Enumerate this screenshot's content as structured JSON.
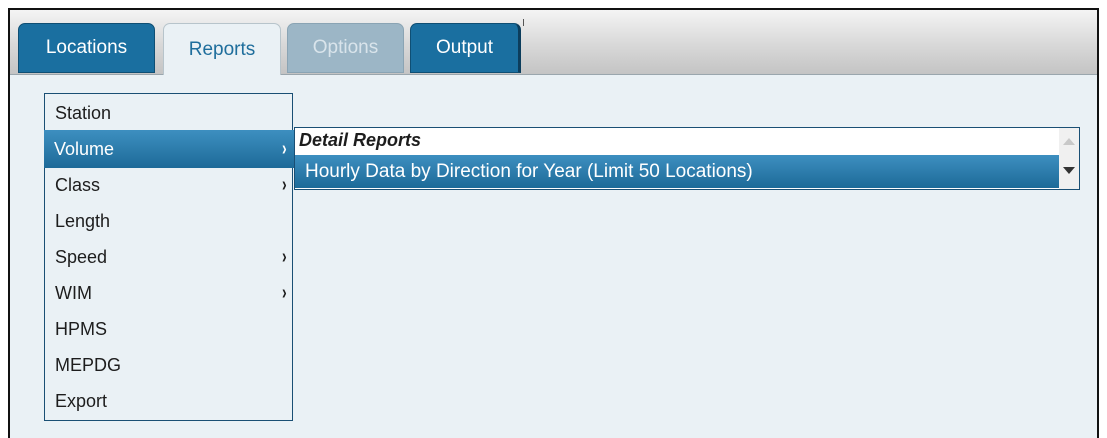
{
  "tabs": {
    "locations": "Locations",
    "reports": "Reports",
    "options": "Options",
    "output": "Output"
  },
  "menu": {
    "items": [
      {
        "label": "Station",
        "has_submenu": false
      },
      {
        "label": "Volume",
        "has_submenu": true,
        "selected": true
      },
      {
        "label": "Class",
        "has_submenu": true
      },
      {
        "label": "Length",
        "has_submenu": false
      },
      {
        "label": "Speed",
        "has_submenu": true
      },
      {
        "label": "WIM",
        "has_submenu": true
      },
      {
        "label": "HPMS",
        "has_submenu": false
      },
      {
        "label": "MEPDG",
        "has_submenu": false
      },
      {
        "label": "Export",
        "has_submenu": false
      }
    ],
    "chevron": "›"
  },
  "submenu": {
    "header": "Detail Reports",
    "item": "Hourly Data by Direction for Year (Limit 50 Locations)"
  },
  "colors": {
    "tab_blue": "#1a6fa0",
    "selection": "#2a7bab",
    "panel_bg": "#eaf1f5"
  }
}
